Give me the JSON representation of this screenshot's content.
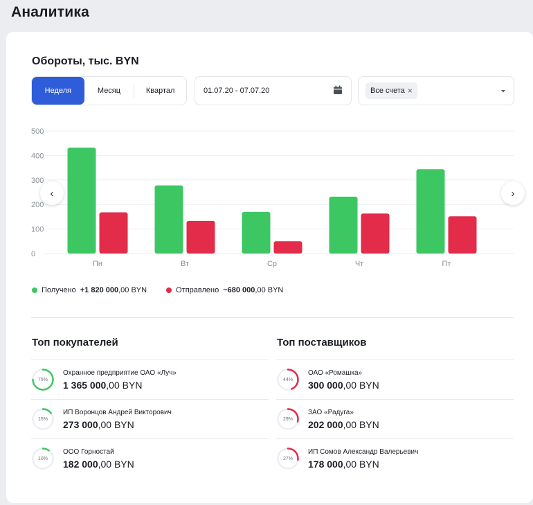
{
  "page_title": "Аналитика",
  "turnover": {
    "title": "Обороты, тыс. BYN",
    "periods": [
      "Неделя",
      "Месяц",
      "Квартал"
    ],
    "active_period": 0,
    "date_range": "01.07.20 - 07.07.20",
    "accounts_chip": "Все счета",
    "chip_close": "×"
  },
  "chart_data": {
    "type": "bar",
    "categories": [
      "Пн",
      "Вт",
      "Ср",
      "Чт",
      "Пт"
    ],
    "series": [
      {
        "name": "Получено",
        "color": "#3dc763",
        "values": [
          432,
          278,
          170,
          232,
          344
        ]
      },
      {
        "name": "Отправлено",
        "color": "#e32b4a",
        "values": [
          168,
          133,
          50,
          163,
          152
        ]
      }
    ],
    "yticks": [
      0,
      100,
      200,
      300,
      400,
      500
    ],
    "ylim": [
      0,
      500
    ],
    "grid": true,
    "legend_position": "bottom-left"
  },
  "legend": {
    "received_label": "Получено",
    "received_bold": "+1 820 000",
    "received_rest": ",00 BYN",
    "sent_label": "Отправлено",
    "sent_bold": "−680 000",
    "sent_rest": ",00 BYN"
  },
  "top_buyers": {
    "title": "Топ покупателей",
    "items": [
      {
        "name": "Охранное предприятие ОАО «Луч»",
        "amount_bold": "1 365 000",
        "amount_rest": ",00 BYN",
        "percent": "75%",
        "fraction": 0.75
      },
      {
        "name": "ИП Воронцов Андрей Викторович",
        "amount_bold": "273 000",
        "amount_rest": ",00 BYN",
        "percent": "15%",
        "fraction": 0.15
      },
      {
        "name": "ООО Горностай",
        "amount_bold": "182 000",
        "amount_rest": ",00 BYN",
        "percent": "10%",
        "fraction": 0.1
      }
    ]
  },
  "top_suppliers": {
    "title": "Топ поставщиков",
    "items": [
      {
        "name": "ОАО «Ромашка»",
        "amount_bold": "300 000",
        "amount_rest": ",00 BYN",
        "percent": "44%",
        "fraction": 0.44
      },
      {
        "name": "ЗАО «Радуга»",
        "amount_bold": "202 000",
        "amount_rest": ",00 BYN",
        "percent": "29%",
        "fraction": 0.29
      },
      {
        "name": "ИП Сомов Александр Валерьевич",
        "amount_bold": "178 000",
        "amount_rest": ",00 BYN",
        "percent": "27%",
        "fraction": 0.27
      }
    ]
  },
  "colors": {
    "accent": "#2f5cd9",
    "received": "#3dc763",
    "sent": "#e32b4a"
  }
}
